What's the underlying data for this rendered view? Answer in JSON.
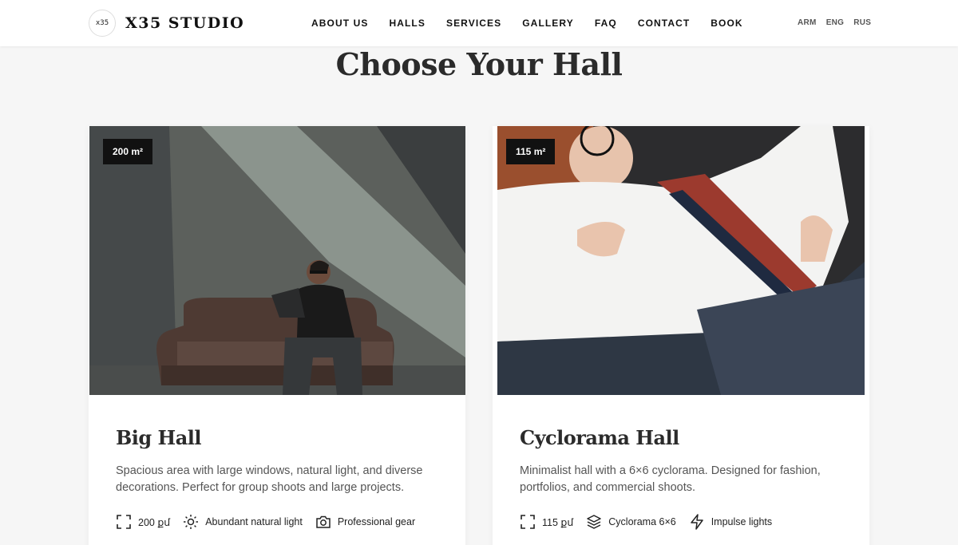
{
  "header": {
    "logo_mark": "x35",
    "brand": "X35 STUDIO",
    "nav": [
      "ABOUT US",
      "HALLS",
      "SERVICES",
      "GALLERY",
      "FAQ",
      "CONTACT",
      "BOOK"
    ],
    "languages": [
      "ARM",
      "ENG",
      "RUS"
    ]
  },
  "page_title": "Choose Your Hall",
  "cards": [
    {
      "badge": "200 m²",
      "title": "Big Hall",
      "description": "Spacious area with large windows, natural light, and diverse decorations. Perfect for group shoots and large projects.",
      "features": [
        {
          "icon": "area-icon",
          "label": "200 քմ"
        },
        {
          "icon": "sun-icon",
          "label": "Abundant natural light"
        },
        {
          "icon": "camera-icon",
          "label": "Professional gear"
        }
      ]
    },
    {
      "badge": "115 m²",
      "title": "Cyclorama Hall",
      "description": "Minimalist hall with a 6×6 cyclorama. Designed for fashion, portfolios, and commercial shoots.",
      "features": [
        {
          "icon": "area-icon",
          "label": "115 քմ"
        },
        {
          "icon": "layers-icon",
          "label": "Cyclorama 6×6"
        },
        {
          "icon": "lightning-icon",
          "label": "Impulse lights"
        }
      ]
    }
  ]
}
